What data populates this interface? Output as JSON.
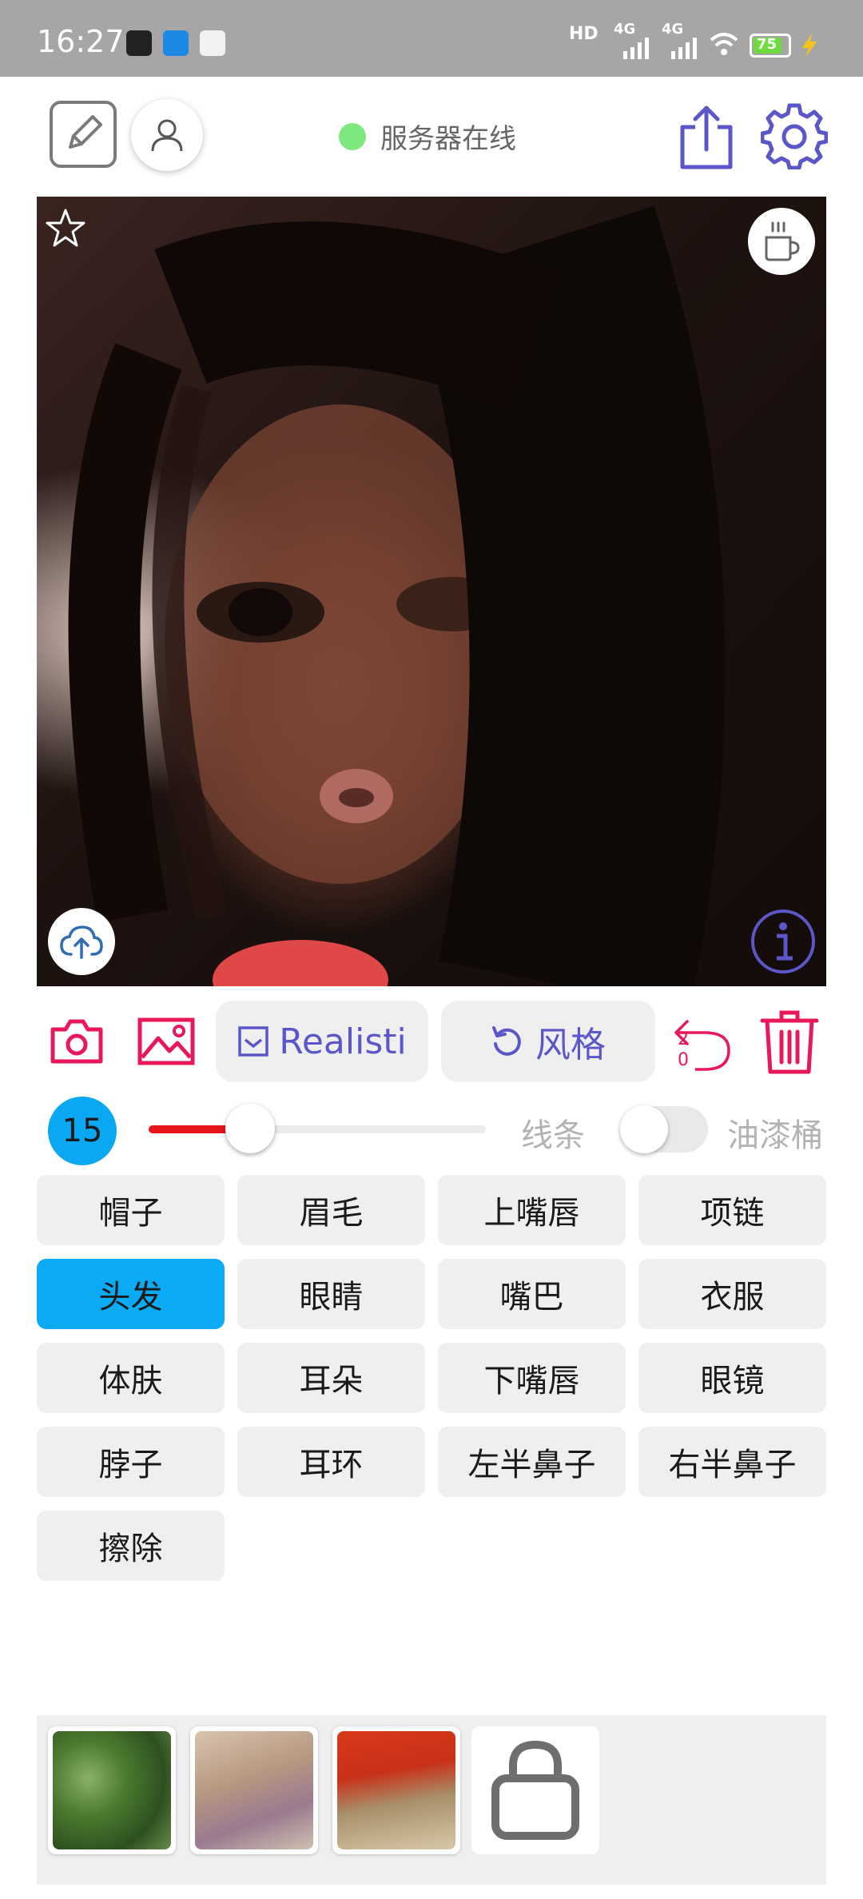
{
  "status_bar": {
    "time": "16:27",
    "network_hd": "HD",
    "network_1": "4G",
    "network_2": "4G",
    "battery": "75"
  },
  "toolbar": {
    "server_status_text": "服务器在线",
    "server_status_color": "#7ee87e",
    "accent_color": "#5b57c9"
  },
  "actions": {
    "style_mode_label": "Realisti",
    "style_button_label": "风格",
    "undo_count_top": "2",
    "undo_count_bottom": "0",
    "delete_color": "#e8195a"
  },
  "brush": {
    "size": "15",
    "slider_fraction": 0.3,
    "line_label": "线条",
    "bucket_label": "油漆桶",
    "bucket_enabled": false
  },
  "parts": [
    {
      "label": "帽子",
      "selected": false
    },
    {
      "label": "眉毛",
      "selected": false
    },
    {
      "label": "上嘴唇",
      "selected": false
    },
    {
      "label": "项链",
      "selected": false
    },
    {
      "label": "头发",
      "selected": true
    },
    {
      "label": "眼睛",
      "selected": false
    },
    {
      "label": "嘴巴",
      "selected": false
    },
    {
      "label": "衣服",
      "selected": false
    },
    {
      "label": "体肤",
      "selected": false
    },
    {
      "label": "耳朵",
      "selected": false
    },
    {
      "label": "下嘴唇",
      "selected": false
    },
    {
      "label": "眼镜",
      "selected": false
    },
    {
      "label": "脖子",
      "selected": false
    },
    {
      "label": "耳环",
      "selected": false
    },
    {
      "label": "左半鼻子",
      "selected": false
    },
    {
      "label": "右半鼻子",
      "selected": false
    },
    {
      "label": "擦除",
      "selected": false
    }
  ],
  "selected_color": "#0aaaf5"
}
